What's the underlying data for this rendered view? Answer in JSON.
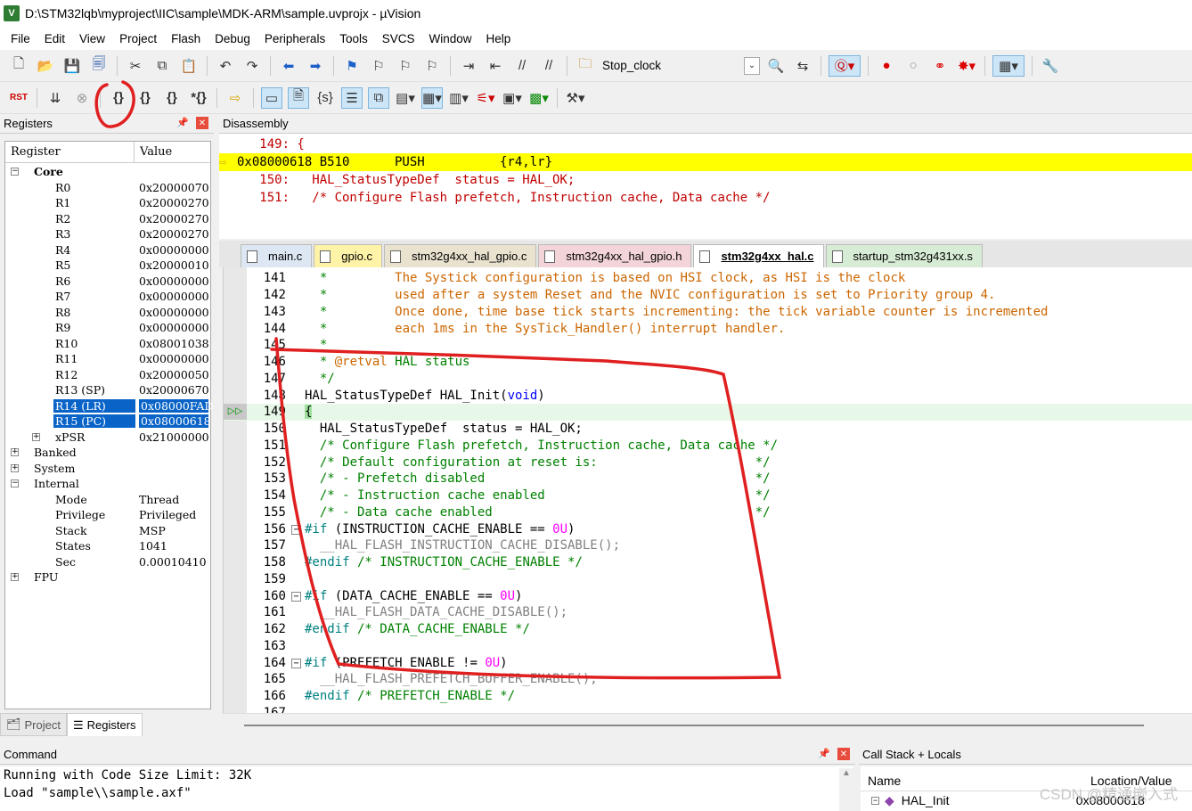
{
  "window": {
    "title": "D:\\STM32lqb\\myproject\\IIC\\sample\\MDK-ARM\\sample.uvprojx - µVision",
    "app_icon": "V"
  },
  "menu": [
    "File",
    "Edit",
    "View",
    "Project",
    "Flash",
    "Debug",
    "Peripherals",
    "Tools",
    "SVCS",
    "Window",
    "Help"
  ],
  "toolbar": {
    "target_combo": "Stop_clock"
  },
  "registers": {
    "title": "Registers",
    "col_register": "Register",
    "col_value": "Value",
    "groups": {
      "core": "Core",
      "banked": "Banked",
      "system": "System",
      "internal": "Internal",
      "fpu": "FPU"
    },
    "core_rows": [
      {
        "name": "R0",
        "value": "0x20000070"
      },
      {
        "name": "R1",
        "value": "0x20000270"
      },
      {
        "name": "R2",
        "value": "0x20000270"
      },
      {
        "name": "R3",
        "value": "0x20000270"
      },
      {
        "name": "R4",
        "value": "0x00000000"
      },
      {
        "name": "R5",
        "value": "0x20000010"
      },
      {
        "name": "R6",
        "value": "0x00000000"
      },
      {
        "name": "R7",
        "value": "0x00000000"
      },
      {
        "name": "R8",
        "value": "0x00000000"
      },
      {
        "name": "R9",
        "value": "0x00000000"
      },
      {
        "name": "R10",
        "value": "0x08001038"
      },
      {
        "name": "R11",
        "value": "0x00000000"
      },
      {
        "name": "R12",
        "value": "0x20000050"
      },
      {
        "name": "R13 (SP)",
        "value": "0x20000670"
      },
      {
        "name": "R14 (LR)",
        "value": "0x08000FAD"
      },
      {
        "name": "R15 (PC)",
        "value": "0x08000618"
      },
      {
        "name": "xPSR",
        "value": "0x21000000"
      }
    ],
    "internal_rows": [
      {
        "name": "Mode",
        "value": "Thread"
      },
      {
        "name": "Privilege",
        "value": "Privileged"
      },
      {
        "name": "Stack",
        "value": "MSP"
      },
      {
        "name": "States",
        "value": "1041"
      },
      {
        "name": "Sec",
        "value": "0.00010410"
      }
    ],
    "tabs": {
      "project": "Project",
      "registers": "Registers"
    }
  },
  "disassembly": {
    "title": "Disassembly",
    "lines": [
      "   149: {",
      "0x08000618 B510      PUSH          {r4,lr}",
      "   150:   HAL_StatusTypeDef  status = HAL_OK;",
      "   151:   /* Configure Flash prefetch, Instruction cache, Data cache */"
    ]
  },
  "editor_tabs": [
    "main.c",
    "gpio.c",
    "stm32g4xx_hal_gpio.c",
    "stm32g4xx_hal_gpio.h",
    "stm32g4xx_hal.c",
    "startup_stm32g431xx.s"
  ],
  "editor_tab_colors": [
    "#dde6f3",
    "#fff3a8",
    "#e9e2cf",
    "#f3d4d8",
    "#ffffff",
    "#d7ecd5"
  ],
  "code": {
    "line_numbers": [
      "141",
      "142",
      "143",
      "144",
      "145",
      "146",
      "147",
      "148",
      "149",
      "150",
      "151",
      "152",
      "153",
      "154",
      "155",
      "156",
      "157",
      "158",
      "159",
      "160",
      "161",
      "162",
      "163",
      "164",
      "165",
      "166",
      "167"
    ],
    "l141_a": "  *         ",
    "l141_b": "The Systick configuration is based on HSI clock, as HSI is the clock",
    "l142_a": "  *         ",
    "l142_b": "used after a system Reset and the NVIC configuration is set to Priority group 4.",
    "l143_a": "  *         ",
    "l143_b": "Once done, time base tick starts incrementing: the tick variable counter is incremented",
    "l144_a": "  *         ",
    "l144_b": "each 1ms in the SysTick_Handler() interrupt handler.",
    "l145": "  *",
    "l146_a": "  * ",
    "l146_b": "@retval",
    "l146_c": " HAL status",
    "l147": "  */",
    "l148_a": "HAL_StatusTypeDef HAL_Init(",
    "l148_b": "void",
    "l148_c": ")",
    "l149": "{",
    "l150": "  HAL_StatusTypeDef  status = HAL_OK;",
    "l151": "  /* Configure Flash prefetch, Instruction cache, Data cache */",
    "l152": "  /* Default configuration at reset is:                     */",
    "l153": "  /* - Prefetch disabled                                    */",
    "l154": "  /* - Instruction cache enabled                            */",
    "l155": "  /* - Data cache enabled                                   */",
    "l156_a": "#if",
    "l156_b": " (INSTRUCTION_CACHE_ENABLE == ",
    "l156_c": "0U",
    "l156_d": ")",
    "l157": "  __HAL_FLASH_INSTRUCTION_CACHE_DISABLE();",
    "l158_a": "#endif",
    "l158_b": " /* INSTRUCTION_CACHE_ENABLE */",
    "l160_a": "#if",
    "l160_b": " (DATA_CACHE_ENABLE == ",
    "l160_c": "0U",
    "l160_d": ")",
    "l161": "  __HAL_FLASH_DATA_CACHE_DISABLE();",
    "l162_a": "#endif",
    "l162_b": " /* DATA_CACHE_ENABLE */",
    "l164_a": "#if",
    "l164_b": " (PREFETCH_ENABLE != ",
    "l164_c": "0U",
    "l164_d": ")",
    "l165": "  __HAL_FLASH_PREFETCH_BUFFER_ENABLE();",
    "l166_a": "#endif",
    "l166_b": " /* PREFETCH_ENABLE */"
  },
  "command": {
    "title": "Command",
    "lines": [
      "Running with Code Size Limit: 32K",
      "Load \"sample\\\\sample.axf\""
    ]
  },
  "callstack": {
    "title": "Call Stack + Locals",
    "col_name": "Name",
    "col_location": "Location/Value",
    "row_name": "HAL_Init",
    "row_value": "0x08000618"
  },
  "watermark": "CSDN @精通嵌入式",
  "colors": {
    "current_line": "#ffff00",
    "selection": "#0a64c8",
    "annotation": "#e02020"
  }
}
